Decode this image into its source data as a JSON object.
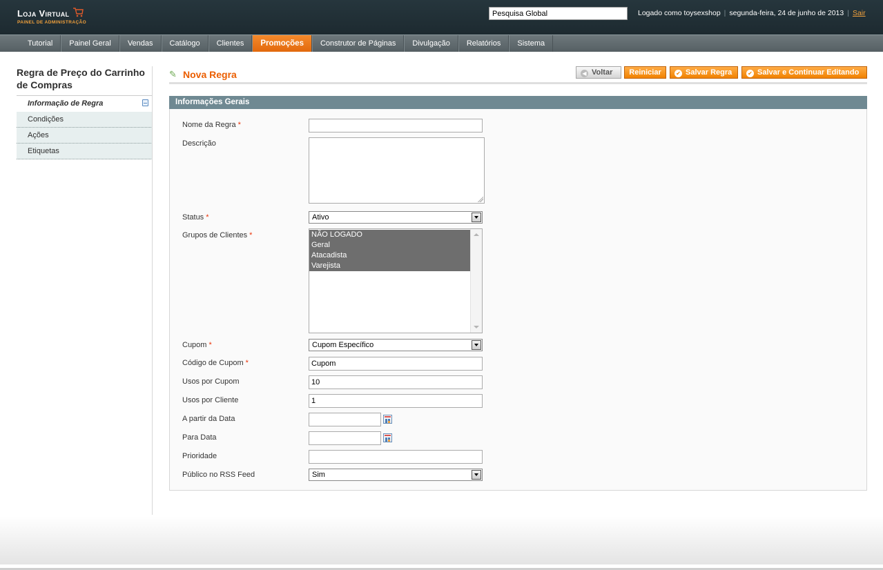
{
  "header": {
    "logo_title": "Loja Virtual",
    "logo_subtitle": "PAINEL DE ADMINISTRAÇÃO",
    "search_value": "Pesquisa Global",
    "logged_as": "Logado como toysexshop",
    "date": "segunda-feira, 24 de junho de 2013",
    "logout": "Sair"
  },
  "nav": {
    "items": [
      "Tutorial",
      "Painel Geral",
      "Vendas",
      "Catálogo",
      "Clientes",
      "Promoções",
      "Construtor de Páginas",
      "Divulgação",
      "Relatórios",
      "Sistema"
    ],
    "active": "Promoções"
  },
  "sidebar": {
    "title": "Regra de Preço do Carrinho de Compras",
    "tabs": [
      "Informação de Regra",
      "Condições",
      "Ações",
      "Etiquetas"
    ],
    "active_tab": "Informação de Regra"
  },
  "content": {
    "title": "Nova Regra",
    "buttons": {
      "back": "Voltar",
      "reset": "Reiniciar",
      "save": "Salvar Regra",
      "save_continue": "Salvar e Continuar Editando"
    }
  },
  "form": {
    "section_title": "Informações Gerais",
    "name_label": "Nome da Regra",
    "name_value": "",
    "description_label": "Descrição",
    "description_value": "",
    "status_label": "Status",
    "status_value": "Ativo",
    "groups_label": "Grupos de Clientes",
    "groups_options": [
      "NÃO LOGADO",
      "Geral",
      "Atacadista",
      "Varejista"
    ],
    "coupon_label": "Cupom",
    "coupon_value": "Cupom Específico",
    "coupon_code_label": "Código de Cupom",
    "coupon_code_value": "Cupom",
    "uses_per_coupon_label": "Usos por Cupom",
    "uses_per_coupon_value": "10",
    "uses_per_customer_label": "Usos por Cliente",
    "uses_per_customer_value": "1",
    "from_date_label": "A partir da Data",
    "from_date_value": "",
    "to_date_label": "Para Data",
    "to_date_value": "",
    "priority_label": "Prioridade",
    "priority_value": "",
    "rss_label": "Público no RSS Feed",
    "rss_value": "Sim",
    "required_mark": "*"
  },
  "colors": {
    "header_bg": "#26363d",
    "nav_active": "#eb6e0f",
    "accent_orange": "#eb5e00",
    "section_header": "#6f8992"
  }
}
